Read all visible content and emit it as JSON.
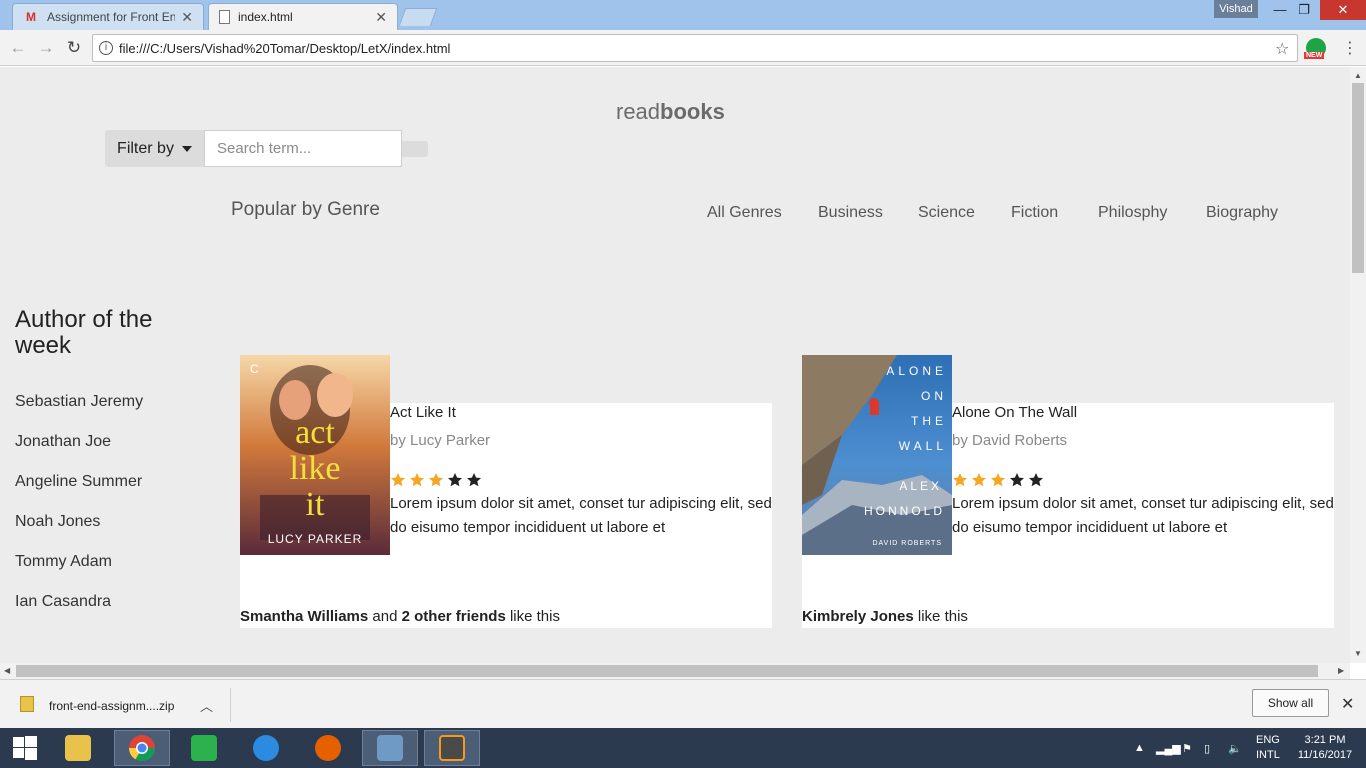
{
  "browser": {
    "tabs": [
      {
        "label": "Assignment for Front Enc",
        "icon": "gmail-icon"
      },
      {
        "label": "index.html",
        "icon": "document-icon"
      }
    ],
    "user_badge": "Vishad",
    "url": "file:///C:/Users/Vishad%20Tomar/Desktop/LetX/index.html",
    "extension_badge": "NEW"
  },
  "page": {
    "logo_light": "read",
    "logo_bold": "books",
    "filter_label": "Filter by",
    "search_placeholder": "Search term...",
    "popular_title": "Popular by Genre",
    "genres": [
      "All Genres",
      "Business",
      "Science",
      "Fiction",
      "Philosphy",
      "Biography"
    ],
    "author_section_title": "Author of the week",
    "authors": [
      "Sebastian Jeremy",
      "Jonathan Joe",
      "Angeline Summer",
      "Noah Jones",
      "Tommy Adam",
      "Ian Casandra"
    ],
    "books": [
      {
        "title": "Act Like It",
        "author": "by Lucy Parker",
        "rating": 3,
        "rating_max": 5,
        "description": "Lorem ipsum dolor sit amet, conset tur adipiscing elit, sed do eisumo tempor incididuent ut labore et",
        "likes_name": "Smantha Williams",
        "likes_and": "and",
        "likes_others": "2 other friends",
        "likes_suffix": "like this",
        "cover_text": "act like it",
        "cover_author": "LUCY PARKER"
      },
      {
        "title": "Alone On The Wall",
        "author": "by David Roberts",
        "rating": 3,
        "rating_max": 5,
        "description": "Lorem ipsum dolor sit amet, conset tur adipiscing elit, sed do eisumo tempor incididuent ut labore et",
        "likes_name": "Kimbrely Jones",
        "likes_suffix": "like this",
        "cover_text": "ALONE ON THE WALL",
        "cover_author": "ALEX HONNOLD",
        "cover_coauthor": "DAVID ROBERTS"
      }
    ],
    "colors": {
      "background": "#ececec",
      "star_filled": "#f5a623",
      "star_empty": "#222222"
    }
  },
  "downloads": {
    "file_name": "front-end-assignm....zip",
    "show_all": "Show all"
  },
  "taskbar": {
    "lang_1": "ENG",
    "lang_2": "INTL",
    "time": "3:21 PM",
    "date": "11/16/2017"
  }
}
